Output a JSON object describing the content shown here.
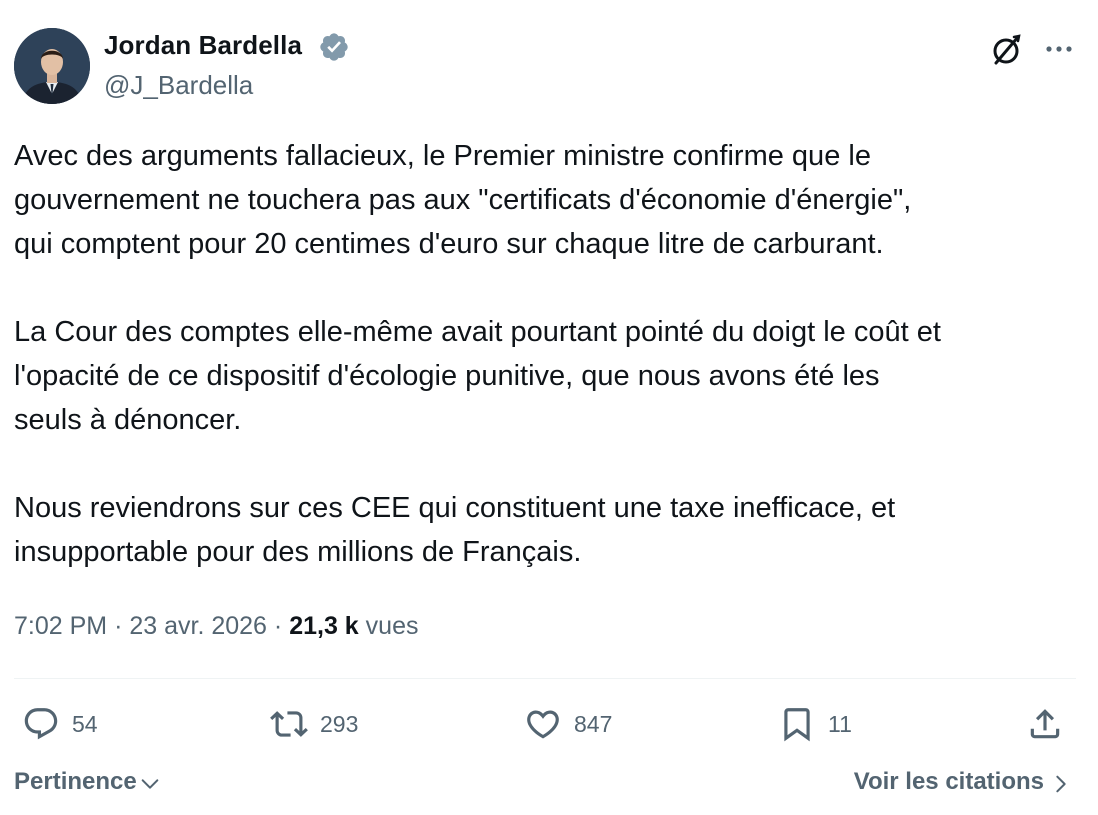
{
  "author": {
    "name": "Jordan Bardella",
    "handle": "@J_Bardella",
    "verified": true,
    "verified_color": "#829aab"
  },
  "header_icons": [
    "grok-icon",
    "more-icon"
  ],
  "post": {
    "paragraphs": [
      "Avec des arguments fallacieux, le Premier ministre confirme que le\ngouvernement ne touchera pas aux \"certificats d'économie d'énergie\",\nqui comptent pour 20 centimes d'euro sur chaque litre de carburant.",
      "La Cour des comptes elle-même avait pourtant pointé du doigt le coût et\nl'opacité de ce dispositif d'écologie punitive, que nous avons été les\nseuls à dénoncer.",
      "Nous reviendrons sur ces CEE qui constituent une taxe inefficace, et\ninsupportable pour des millions de Français."
    ]
  },
  "meta": {
    "time": "7:02 PM",
    "separator": "·",
    "date": "23 avr. 2026",
    "views_count": "21,3 k",
    "views_label": "vues"
  },
  "actions": {
    "replies": "54",
    "retweets": "293",
    "likes": "847",
    "bookmarks": "11"
  },
  "footer": {
    "sort_label": "Pertinence",
    "quotes_label": "Voir les citations"
  },
  "colors": {
    "text": "#0f1419",
    "secondary": "#536471",
    "divider": "#eff3f4"
  }
}
